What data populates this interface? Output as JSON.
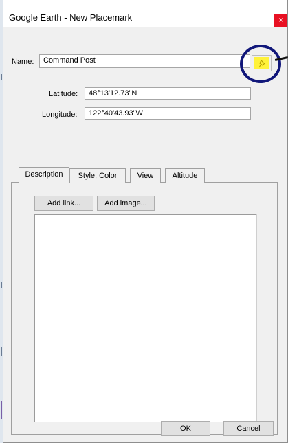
{
  "window": {
    "title": "Google Earth - New Placemark",
    "close_label": "×"
  },
  "form": {
    "name_label": "Name:",
    "name_value": "Command Post",
    "latitude_label": "Latitude:",
    "latitude_value": "48°13'12.73\"N",
    "longitude_label": "Longitude:",
    "longitude_value": "122°40'43.93\"W"
  },
  "tabs": [
    {
      "label": "Description",
      "selected": true
    },
    {
      "label": "Style, Color",
      "selected": false
    },
    {
      "label": "View",
      "selected": false
    },
    {
      "label": "Altitude",
      "selected": false
    }
  ],
  "description": {
    "add_link_label": "Add link...",
    "add_image_label": "Add image...",
    "text_value": ""
  },
  "footer": {
    "ok_label": "OK",
    "cancel_label": "Cancel"
  },
  "icons": {
    "placemark_icon": "pushpin-icon",
    "close_icon": "close-icon"
  },
  "colors": {
    "close_button": "#e81123",
    "pin_icon_fill": "#fff23a",
    "annotation_circle": "#11177a"
  }
}
